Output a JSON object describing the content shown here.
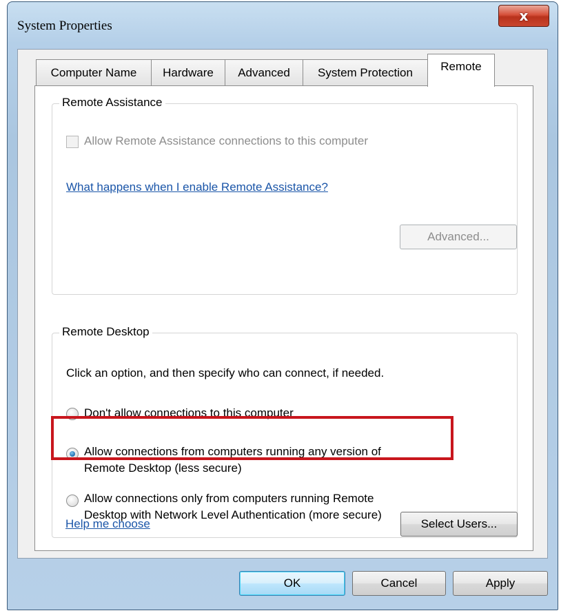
{
  "window": {
    "title": "System Properties",
    "close_glyph": "x"
  },
  "tabs": [
    {
      "label": "Computer Name"
    },
    {
      "label": "Hardware"
    },
    {
      "label": "Advanced"
    },
    {
      "label": "System Protection"
    },
    {
      "label": "Remote"
    }
  ],
  "remote_assistance": {
    "group_title": "Remote Assistance",
    "checkbox_label": "Allow Remote Assistance connections to this computer",
    "checkbox_checked": false,
    "help_link": "What happens when I enable Remote Assistance?",
    "advanced_button": "Advanced..."
  },
  "remote_desktop": {
    "group_title": "Remote Desktop",
    "instructions": "Click an option, and then specify who can connect, if needed.",
    "options": [
      {
        "line1": "Don't allow connections to this computer",
        "line2": "",
        "selected": false
      },
      {
        "line1": "Allow connections from computers running any version of",
        "line2": "Remote Desktop (less secure)",
        "selected": true
      },
      {
        "line1": "Allow connections only from computers running Remote",
        "line2": "Desktop with Network Level Authentication (more secure)",
        "selected": false
      }
    ],
    "help_link": "Help me choose",
    "select_users_button": "Select Users..."
  },
  "buttons": {
    "ok": "OK",
    "cancel": "Cancel",
    "apply": "Apply"
  },
  "colors": {
    "highlight": "#c8161d",
    "link": "#1a55a8",
    "close_button": "#c9452e"
  },
  "icons": {
    "close": "close-icon",
    "radio": "radio-button",
    "checkbox": "checkbox"
  }
}
